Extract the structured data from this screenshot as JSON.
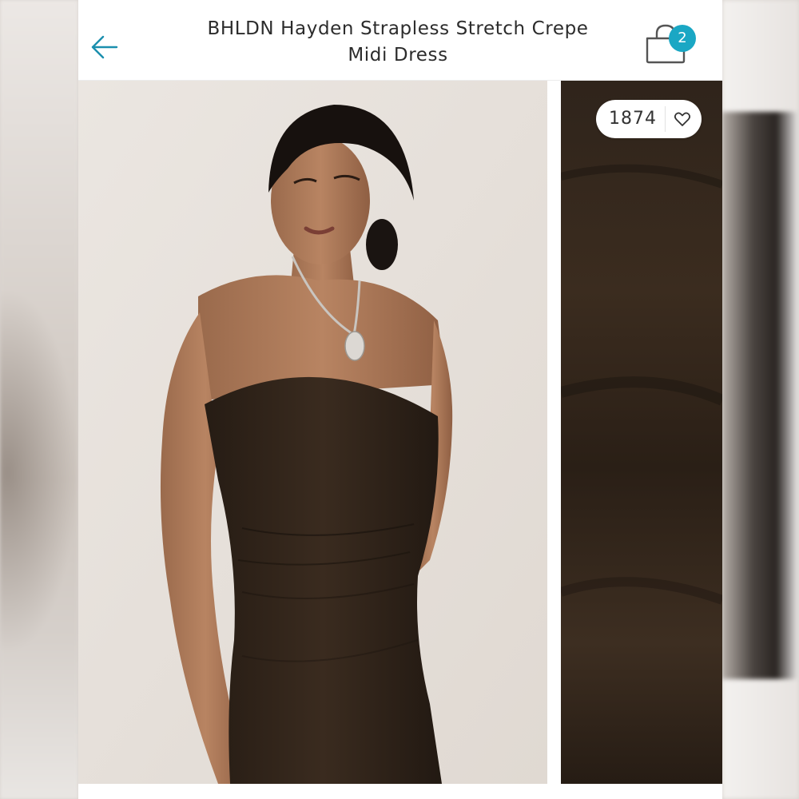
{
  "header": {
    "title": "BHLDN Hayden Strapless Stretch Crepe Midi Dress",
    "back_icon": "arrow-left-icon",
    "cart_icon": "shopping-bag-icon",
    "cart_count": "2"
  },
  "gallery": {
    "main_image": "model-wearing-brown-strapless-dress",
    "swatch_image": "fabric-closeup-brown-crepe",
    "like_count": "1874",
    "like_icon": "heart-outline-icon"
  },
  "colors": {
    "accent": "#1aa7c4",
    "dress": "#2e2218",
    "background": "#e8e2dc"
  }
}
